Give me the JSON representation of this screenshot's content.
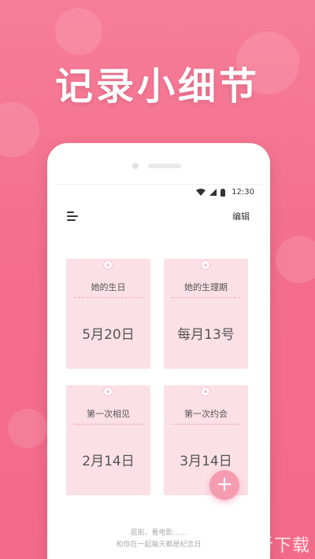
{
  "headline": "记录小细节",
  "status_bar": {
    "time": "12:30"
  },
  "header": {
    "edit_label": "编辑"
  },
  "cards": [
    {
      "title": "她的生日",
      "value": "5月20日"
    },
    {
      "title": "她的生理期",
      "value": "每月13号"
    },
    {
      "title": "第一次相见",
      "value": "2月14日"
    },
    {
      "title": "第一次约会",
      "value": "3月14日"
    }
  ],
  "fab_label": "+",
  "footer_lines": [
    "逛街、看电影……",
    "和你在一起每天都是纪念日"
  ],
  "watermark": {
    "logo_text": "听",
    "text": "一听下载"
  },
  "colors": {
    "background": "#f46f8c",
    "card": "#fbe0e6",
    "accent": "#f59cb1"
  }
}
